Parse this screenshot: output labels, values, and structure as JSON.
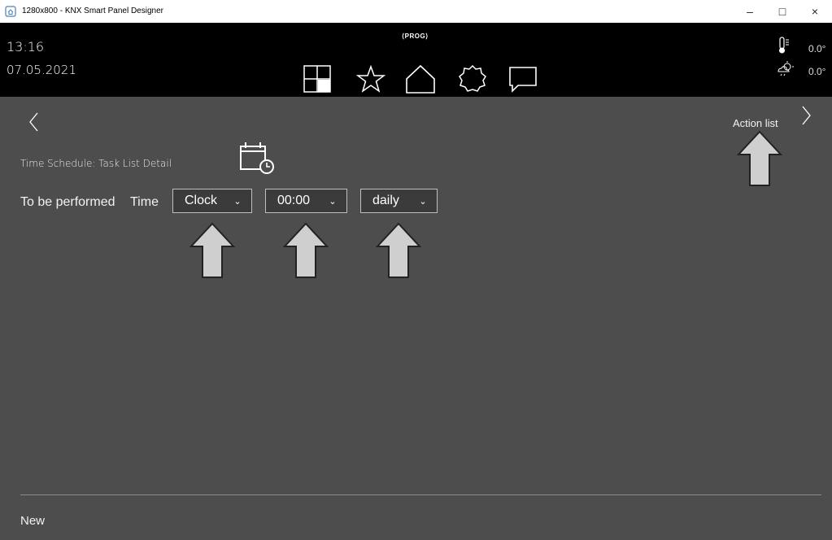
{
  "window": {
    "title": "1280x800 - KNX Smart Panel Designer",
    "minimize": "–",
    "maximize": "□",
    "close": "×"
  },
  "header": {
    "time": "13:16",
    "date": "07.05.2021",
    "prog": "⟨PROG⟩",
    "nav_icons": [
      "rooms-icon",
      "favorites-icon",
      "home-icon",
      "settings-icon",
      "messages-icon"
    ],
    "weather": {
      "indoor_temp": "0.0°",
      "outdoor_temp": "0.0°"
    }
  },
  "main": {
    "action_list_label": "Action list",
    "schedule_title": "Time Schedule: Task List Detail",
    "performed_label": "To be performed",
    "time_label": "Time",
    "dropdowns": {
      "mode": "Clock",
      "time": "00:00",
      "repeat": "daily"
    },
    "new_label": "New"
  }
}
